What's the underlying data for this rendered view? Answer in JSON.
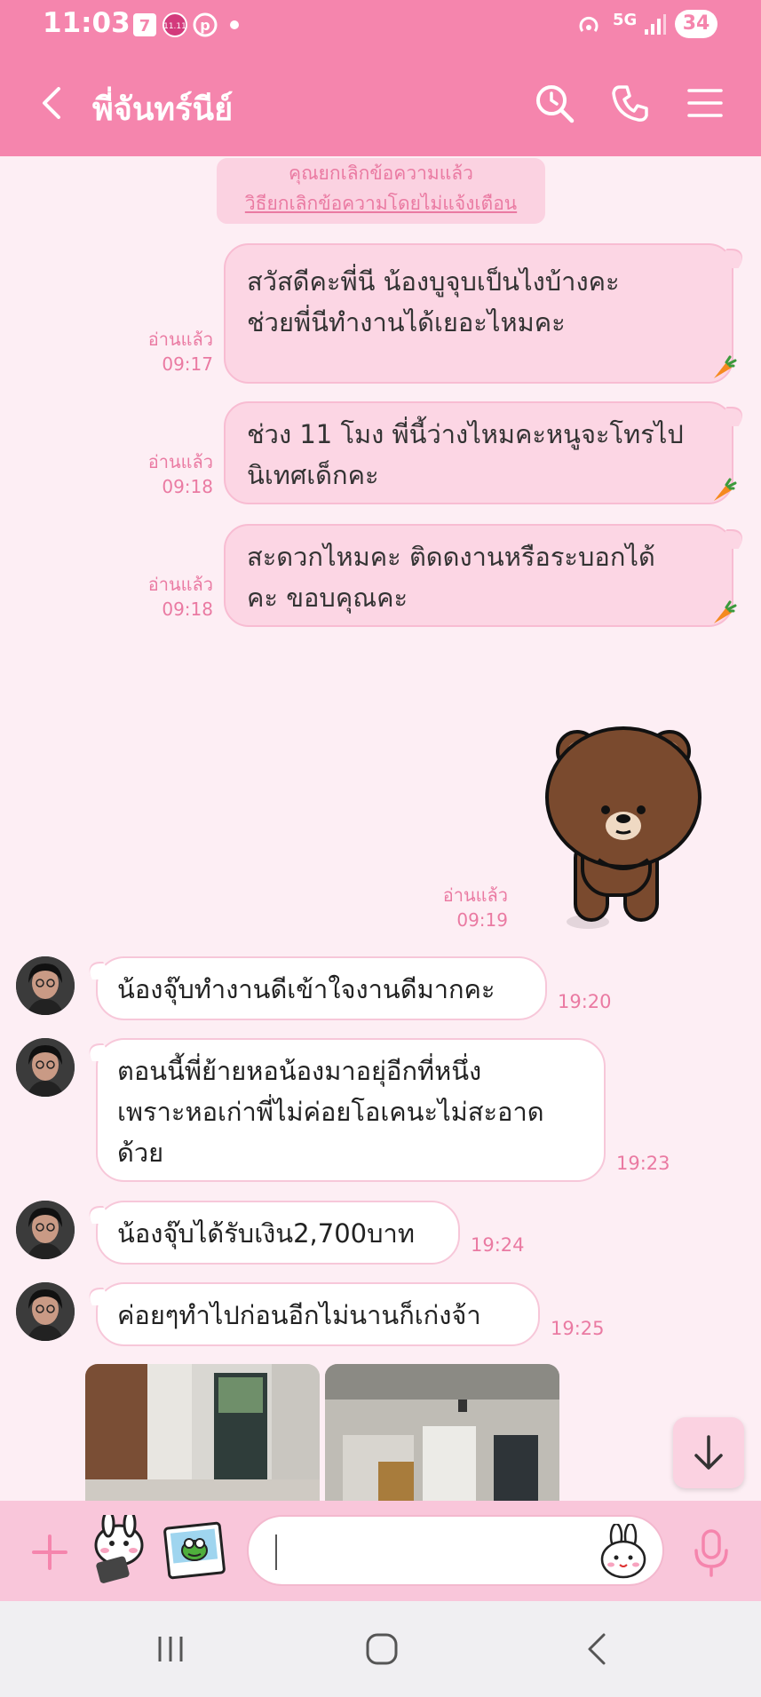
{
  "status_bar": {
    "time": "11:03",
    "battery": "34",
    "network": "5G"
  },
  "header": {
    "back_icon": "chevron-left-icon",
    "title": "พี่จันทร์นีย์",
    "search_icon": "search-icon",
    "call_icon": "phone-icon",
    "menu_icon": "menu-icon"
  },
  "notice": {
    "line1": "คุณยกเลิกข้อความแล้ว",
    "link": "วิธียกเลิกข้อความโดยไม่แจ้งเตือน"
  },
  "outgoing": [
    {
      "line1": "สวัสดีคะพี่นี น้องบูจุบเป็นไงบ้างคะ",
      "line2": "ช่วยพี่นีทำงานได้เยอะไหมคะ",
      "read": "อ่านแล้ว",
      "time": "09:17"
    },
    {
      "line1": "ช่วง 11 โมง พี่นี้ว่างไหมคะหนูจะโทรไป",
      "line2": "นิเทศเด็กคะ",
      "read": "อ่านแล้ว",
      "time": "09:18"
    },
    {
      "line1": "สะดวกไหมคะ ติดดงานหรือระบอกได้",
      "line2": "คะ ขอบคุณคะ",
      "read": "อ่านแล้ว",
      "time": "09:18"
    }
  ],
  "sticker": {
    "read": "อ่านแล้ว",
    "time": "09:19",
    "icon": "brown-bear-sticker"
  },
  "incoming": [
    {
      "text": "น้องจุ๊บทำงานดีเข้าใจงานดีมากคะ",
      "time": "19:20"
    },
    {
      "line1": "ตอนนี้พี่ย้ายหอน้องมาอยุ่อีกที่หนึ่ง",
      "line2": "เพราะหอเก่าพี่ไม่ค่อยโอเคนะไม่สะอาด",
      "line3": "ด้วย",
      "time": "19:23"
    },
    {
      "text": "น้องจุ๊บได้รับเงิน2,700บาท",
      "time": "19:24"
    },
    {
      "text": "ค่อยๆทำไปก่อนอีกไม่นานก็เก่งจ้า",
      "time": "19:25"
    }
  ],
  "input": {
    "placeholder": "",
    "plus_icon": "plus-icon",
    "sticker_icon": "sticker-icon",
    "image_icon": "image-icon",
    "emoji_icon": "emoji-icon",
    "mic_icon": "microphone-icon"
  },
  "colors": {
    "accent": "#f585ad",
    "bubble_out": "#fcd6e4",
    "background": "#fdeef4"
  }
}
